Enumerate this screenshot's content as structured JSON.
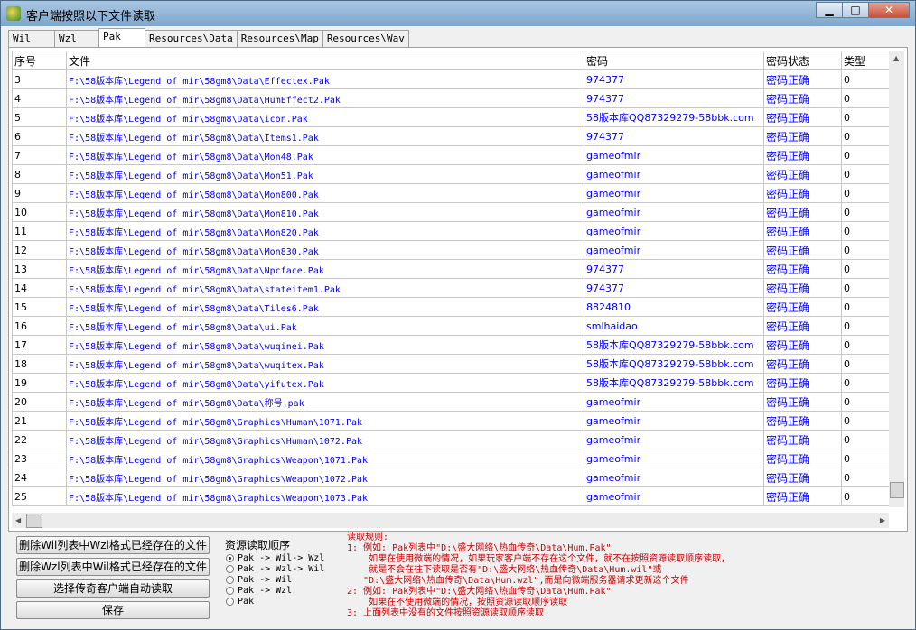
{
  "window": {
    "title": "客户端按照以下文件读取",
    "minimize": "▁",
    "maximize": "□",
    "close": "✕"
  },
  "tabs": [
    "Wil",
    "Wzl",
    "Pak",
    "Resources\\Data",
    "Resources\\Map",
    "Resources\\Wav"
  ],
  "active_tab": "Pak",
  "table": {
    "headers": [
      "序号",
      "文件",
      "密码",
      "密码状态",
      "类型"
    ],
    "rows": [
      [
        "3",
        "F:\\58版本库\\Legend of mir\\58gm8\\Data\\Effectex.Pak",
        "974377",
        "密码正确",
        "0"
      ],
      [
        "4",
        "F:\\58版本库\\Legend of mir\\58gm8\\Data\\HumEffect2.Pak",
        "974377",
        "密码正确",
        "0"
      ],
      [
        "5",
        "F:\\58版本库\\Legend of mir\\58gm8\\Data\\icon.Pak",
        "58版本库QQ87329279-58bbk.com",
        "密码正确",
        "0"
      ],
      [
        "6",
        "F:\\58版本库\\Legend of mir\\58gm8\\Data\\Items1.Pak",
        "974377",
        "密码正确",
        "0"
      ],
      [
        "7",
        "F:\\58版本库\\Legend of mir\\58gm8\\Data\\Mon48.Pak",
        "gameofmir",
        "密码正确",
        "0"
      ],
      [
        "8",
        "F:\\58版本库\\Legend of mir\\58gm8\\Data\\Mon51.Pak",
        "gameofmir",
        "密码正确",
        "0"
      ],
      [
        "9",
        "F:\\58版本库\\Legend of mir\\58gm8\\Data\\Mon800.Pak",
        "gameofmir",
        "密码正确",
        "0"
      ],
      [
        "10",
        "F:\\58版本库\\Legend of mir\\58gm8\\Data\\Mon810.Pak",
        "gameofmir",
        "密码正确",
        "0"
      ],
      [
        "11",
        "F:\\58版本库\\Legend of mir\\58gm8\\Data\\Mon820.Pak",
        "gameofmir",
        "密码正确",
        "0"
      ],
      [
        "12",
        "F:\\58版本库\\Legend of mir\\58gm8\\Data\\Mon830.Pak",
        "gameofmir",
        "密码正确",
        "0"
      ],
      [
        "13",
        "F:\\58版本库\\Legend of mir\\58gm8\\Data\\Npcface.Pak",
        "974377",
        "密码正确",
        "0"
      ],
      [
        "14",
        "F:\\58版本库\\Legend of mir\\58gm8\\Data\\stateitem1.Pak",
        "974377",
        "密码正确",
        "0"
      ],
      [
        "15",
        "F:\\58版本库\\Legend of mir\\58gm8\\Data\\Tiles6.Pak",
        "8824810",
        "密码正确",
        "0"
      ],
      [
        "16",
        "F:\\58版本库\\Legend of mir\\58gm8\\Data\\ui.Pak",
        "smlhaidao",
        "密码正确",
        "0"
      ],
      [
        "17",
        "F:\\58版本库\\Legend of mir\\58gm8\\Data\\wuqinei.Pak",
        "58版本库QQ87329279-58bbk.com",
        "密码正确",
        "0"
      ],
      [
        "18",
        "F:\\58版本库\\Legend of mir\\58gm8\\Data\\wuqitex.Pak",
        "58版本库QQ87329279-58bbk.com",
        "密码正确",
        "0"
      ],
      [
        "19",
        "F:\\58版本库\\Legend of mir\\58gm8\\Data\\yifutex.Pak",
        "58版本库QQ87329279-58bbk.com",
        "密码正确",
        "0"
      ],
      [
        "20",
        "F:\\58版本库\\Legend of mir\\58gm8\\Data\\称号.pak",
        "gameofmir",
        "密码正确",
        "0"
      ],
      [
        "21",
        "F:\\58版本库\\Legend of mir\\58gm8\\Graphics\\Human\\1071.Pak",
        "gameofmir",
        "密码正确",
        "0"
      ],
      [
        "22",
        "F:\\58版本库\\Legend of mir\\58gm8\\Graphics\\Human\\1072.Pak",
        "gameofmir",
        "密码正确",
        "0"
      ],
      [
        "23",
        "F:\\58版本库\\Legend of mir\\58gm8\\Graphics\\Weapon\\1071.Pak",
        "gameofmir",
        "密码正确",
        "0"
      ],
      [
        "24",
        "F:\\58版本库\\Legend of mir\\58gm8\\Graphics\\Weapon\\1072.Pak",
        "gameofmir",
        "密码正确",
        "0"
      ],
      [
        "25",
        "F:\\58版本库\\Legend of mir\\58gm8\\Graphics\\Weapon\\1073.Pak",
        "gameofmir",
        "密码正确",
        "0"
      ]
    ]
  },
  "buttons": {
    "delete_wil": "删除Wil列表中Wzl格式已经存在的文件",
    "delete_wzl": "删除Wzl列表中Wil格式已经存在的文件",
    "auto_read": "选择传奇客户端自动读取",
    "save": "保存"
  },
  "read_order": {
    "title": "资源读取顺序",
    "options": [
      "Pak -> Wil-> Wzl",
      "Pak -> Wzl-> Wil",
      "Pak -> Wil",
      "Pak -> Wzl",
      "Pak"
    ],
    "selected": 0
  },
  "rules": [
    "读取规则:",
    "1: 例如: Pak列表中\"D:\\盛大网络\\热血传奇\\Data\\Hum.Pak\"",
    "    如果在使用微端的情况，如果玩家客户端不存在这个文件，就不在按照资源读取顺序读取，",
    "    就是不会在往下读取是否有\"D:\\盛大网络\\热血传奇\\Data\\Hum.wil\"或",
    "   \"D:\\盛大网络\\热血传奇\\Data\\Hum.wzl\",而是向微端服务器请求更新这个文件",
    "2: 例如: Pak列表中\"D:\\盛大网络\\热血传奇\\Data\\Hum.Pak\"",
    "    如果在不使用微端的情况，按照资源读取顺序读取",
    "3: 上面列表中没有的文件按照资源读取顺序读取"
  ]
}
